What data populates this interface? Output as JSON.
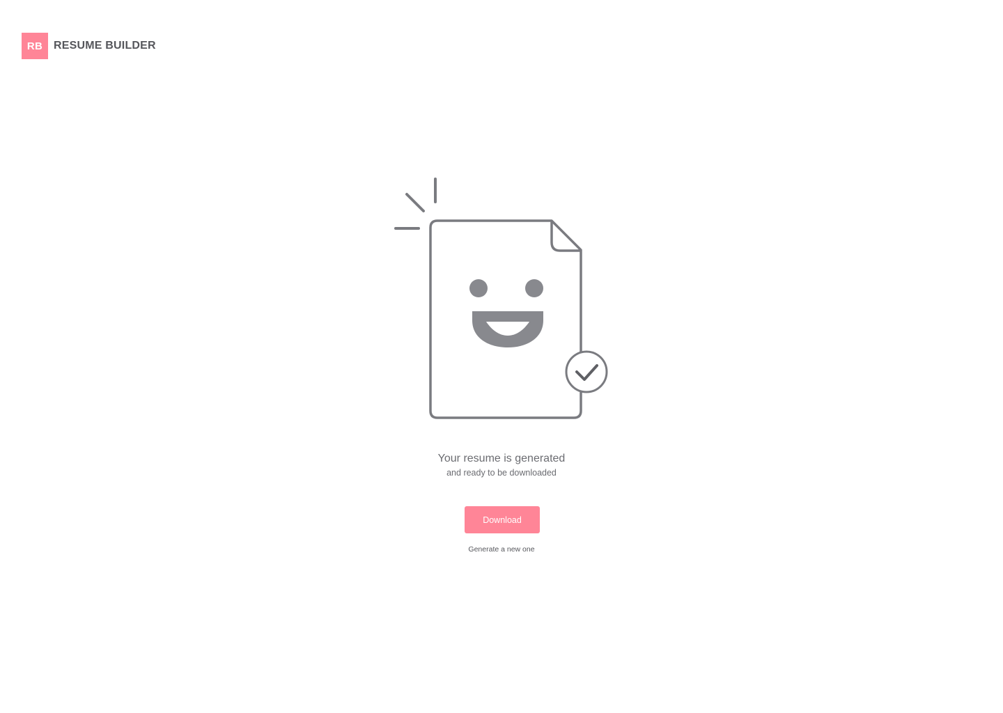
{
  "brand": {
    "mark": "RB",
    "name": "RESUME BUILDER"
  },
  "illustration": {
    "icon": "happy-document-check-icon"
  },
  "message": {
    "headline": "Your resume is generated",
    "subline": "and ready to be downloaded"
  },
  "actions": {
    "download_label": "Download",
    "regenerate_label": "Generate a new one"
  },
  "colors": {
    "accent": "#ff8597",
    "text": "#6b6c71",
    "illustration_stroke": "#7a7b80"
  }
}
